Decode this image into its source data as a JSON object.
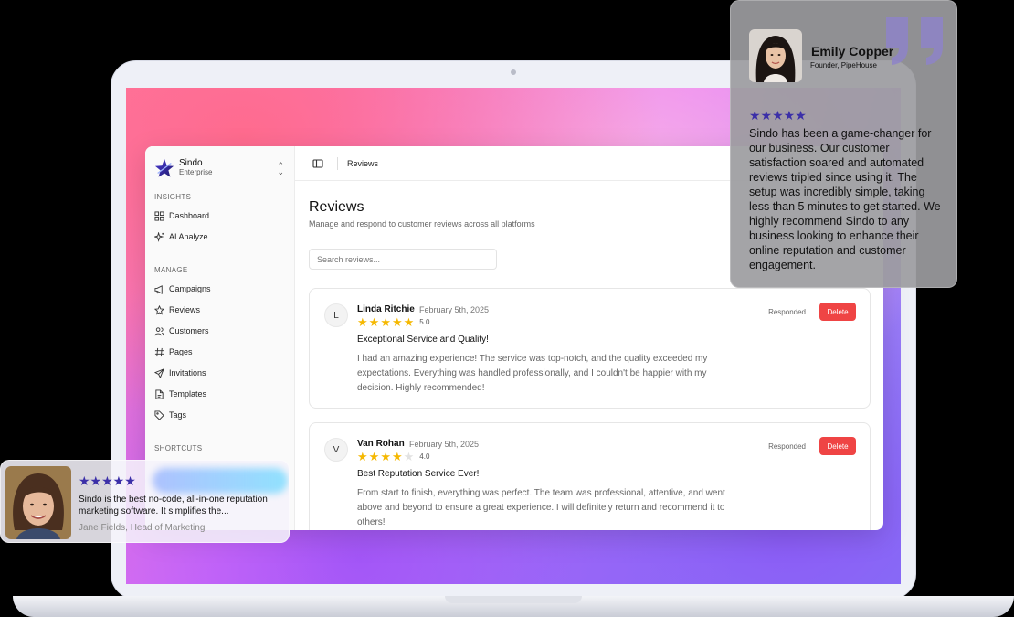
{
  "brand": {
    "name": "Sindo",
    "plan": "Enterprise",
    "switch_icon": "chevron-up-down-icon"
  },
  "sidebar": {
    "sections": [
      {
        "label": "INSIGHTS",
        "items": [
          {
            "label": "Dashboard",
            "icon": "grid-icon"
          },
          {
            "label": "AI Analyze",
            "icon": "sparkles-icon"
          }
        ]
      },
      {
        "label": "MANAGE",
        "items": [
          {
            "label": "Campaigns",
            "icon": "megaphone-icon"
          },
          {
            "label": "Reviews",
            "icon": "star-icon"
          },
          {
            "label": "Customers",
            "icon": "users-icon"
          },
          {
            "label": "Pages",
            "icon": "hash-icon"
          },
          {
            "label": "Invitations",
            "icon": "send-icon"
          },
          {
            "label": "Templates",
            "icon": "file-icon"
          },
          {
            "label": "Tags",
            "icon": "tag-icon"
          }
        ]
      },
      {
        "label": "SHORTCUTS",
        "items": []
      }
    ]
  },
  "topbar": {
    "breadcrumb": "Reviews"
  },
  "main": {
    "title": "Reviews",
    "subtitle": "Manage and respond to customer reviews across all platforms",
    "search_placeholder": "Search reviews..."
  },
  "reviews": [
    {
      "initial": "L",
      "name": "Linda Ritchie",
      "date": "February 5th, 2025",
      "rating": 5,
      "rating_text": "5.0",
      "title": "Exceptional Service and Quality!",
      "body": "I had an amazing experience! The service was top-notch, and the quality exceeded my expectations. Everything was handled professionally, and I couldn't be happier with my decision. Highly recommended!",
      "status": "Responded",
      "delete_label": "Delete"
    },
    {
      "initial": "V",
      "name": "Van Rohan",
      "date": "February 5th, 2025",
      "rating": 4,
      "rating_text": "4.0",
      "title": "Best Reputation Service Ever!",
      "body": "From start to finish, everything was perfect. The team was professional, attentive, and went above and beyond to ensure a great experience. I will definitely return and recommend it to others!",
      "status": "Responded",
      "delete_label": "Delete"
    }
  ],
  "testimonial_main": {
    "name": "Emily Copper",
    "role": "Founder, PipeHouse",
    "stars": "★★★★★",
    "text": "Sindo has been a game-changer for our business. Our customer satisfaction soared and automated reviews tripled since using it. The setup was incredibly simple, taking less than 5 minutes to get started. We highly recommend Sindo to any business looking to enhance their online reputation and customer engagement."
  },
  "testimonial_mini": {
    "stars": "★★★★★",
    "text": "Sindo is the best no-code, all-in-one reputation marketing software. It simplifies the...",
    "author": "Jane Fields, Head of Marketing"
  },
  "colors": {
    "accent": "#3b2fa8",
    "star": "#f5b800",
    "danger": "#ef4444"
  }
}
